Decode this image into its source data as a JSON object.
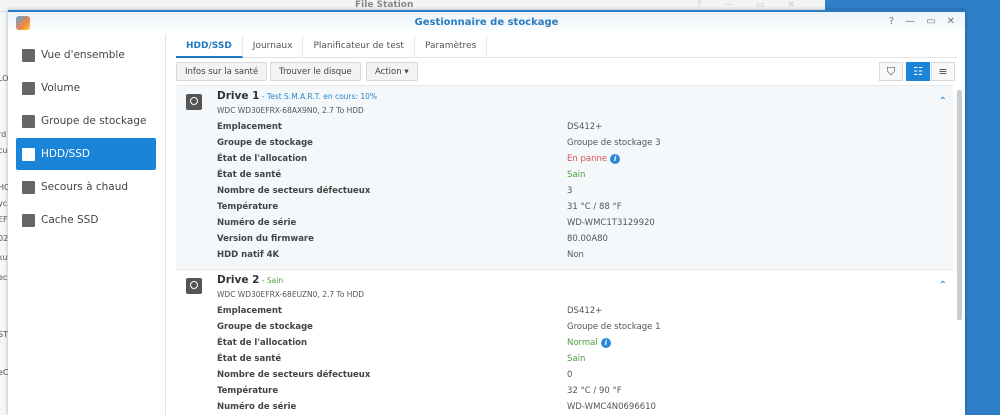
{
  "background": {
    "window_title": "File Station",
    "left_fragments": [
      "LO",
      "rd",
      "cu",
      "HC",
      "yc",
      "EF",
      "02",
      "ku",
      "ec",
      "ST",
      "eC"
    ]
  },
  "window": {
    "title": "Gestionnaire de stockage",
    "controls": [
      "?",
      "—",
      "▭",
      "✕"
    ]
  },
  "sidebar": {
    "items": [
      {
        "label": "Vue d'ensemble",
        "icon": "overview-icon"
      },
      {
        "label": "Volume",
        "icon": "volume-icon"
      },
      {
        "label": "Groupe de stockage",
        "icon": "storage-pool-icon"
      },
      {
        "label": "HDD/SSD",
        "icon": "hdd-icon",
        "selected": true
      },
      {
        "label": "Secours à chaud",
        "icon": "hot-spare-icon"
      },
      {
        "label": "Cache SSD",
        "icon": "ssd-cache-icon"
      }
    ]
  },
  "tabs": [
    {
      "label": "HDD/SSD",
      "selected": true
    },
    {
      "label": "Journaux"
    },
    {
      "label": "Planificateur de test"
    },
    {
      "label": "Paramètres"
    }
  ],
  "toolbar": {
    "health_info": "Infos sur la santé",
    "find_disk": "Trouver le disque",
    "action": "Action ▾"
  },
  "colors": {
    "accent": "#1a84d8",
    "error": "#d9534f",
    "ok": "#4a9d3a"
  },
  "drives": [
    {
      "name": "Drive 1",
      "status": " - Test S.M.A.R.T. en cours: 10%",
      "model": "WDC WD30EFRX-68AX9N0, 2.7 To HDD",
      "rows": [
        [
          "Emplacement",
          "DS412+"
        ],
        [
          "Groupe de stockage",
          "Groupe de stockage 3"
        ],
        [
          "État de l'allocation",
          "En panne"
        ],
        [
          "État de santé",
          "Sain"
        ],
        [
          "Nombre de secteurs défectueux",
          "3"
        ],
        [
          "Température",
          "31 °C / 88 °F"
        ],
        [
          "Numéro de série",
          "WD-WMC1T3129920"
        ],
        [
          "Version du firmware",
          "80.00A80"
        ],
        [
          "HDD natif 4K",
          "Non"
        ]
      ]
    },
    {
      "name": "Drive 2",
      "status": " - Sain",
      "model": "WDC WD30EFRX-68EUZN0, 2.7 To HDD",
      "rows": [
        [
          "Emplacement",
          "DS412+"
        ],
        [
          "Groupe de stockage",
          "Groupe de stockage 1"
        ],
        [
          "État de l'allocation",
          "Normal"
        ],
        [
          "État de santé",
          "Sain"
        ],
        [
          "Nombre de secteurs défectueux",
          "0"
        ],
        [
          "Température",
          "32 °C / 90 °F"
        ],
        [
          "Numéro de série",
          "WD-WMC4N0696610"
        ]
      ]
    }
  ]
}
